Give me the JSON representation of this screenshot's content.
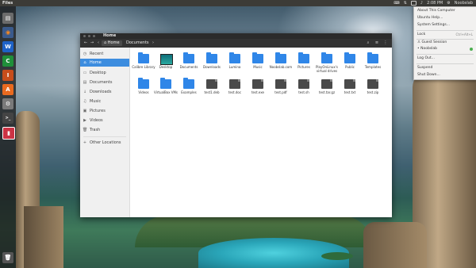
{
  "top_panel": {
    "app_title": "Files",
    "clock": "2:08 PM",
    "user": "Noobslab"
  },
  "launcher": {
    "items": [
      {
        "name": "files",
        "glyph": "▤",
        "color": "#6b6b6b"
      },
      {
        "name": "firefox",
        "glyph": "◉",
        "color": "#e66000"
      },
      {
        "name": "writer",
        "glyph": "W",
        "color": "#1e62c7"
      },
      {
        "name": "calc",
        "glyph": "C",
        "color": "#1f8f3a"
      },
      {
        "name": "impress",
        "glyph": "I",
        "color": "#c84d1b"
      },
      {
        "name": "software-center",
        "glyph": "A",
        "color": "#e96a1f"
      },
      {
        "name": "settings",
        "glyph": "⚙",
        "color": "#7a7a7a"
      },
      {
        "name": "terminal",
        "glyph": ">_",
        "color": "#444444"
      },
      {
        "name": "active-app",
        "glyph": "▮",
        "color": "#cc3344"
      },
      {
        "name": "trash",
        "glyph": "🗑",
        "color": "#555555"
      }
    ]
  },
  "window": {
    "title": "Home",
    "toolbar": {
      "back_icon": "←",
      "forward_icon": "→",
      "prev_icon": "‹",
      "home_label": "Home",
      "documents_label": "Documents",
      "next_icon": "›",
      "search_icon": "⌕",
      "list_icon": "≡",
      "menu_icon": "⋮"
    },
    "sidebar": {
      "items": [
        {
          "icon": "◷",
          "label": "Recent",
          "active": false
        },
        {
          "icon": "⌂",
          "label": "Home",
          "active": true
        },
        {
          "icon": "▭",
          "label": "Desktop",
          "active": false
        },
        {
          "icon": "▤",
          "label": "Documents",
          "active": false
        },
        {
          "icon": "↓",
          "label": "Downloads",
          "active": false
        },
        {
          "icon": "♫",
          "label": "Music",
          "active": false
        },
        {
          "icon": "▣",
          "label": "Pictures",
          "active": false
        },
        {
          "icon": "▶",
          "label": "Videos",
          "active": false
        },
        {
          "icon": "🗑",
          "label": "Trash",
          "active": false
        },
        {
          "icon": "+",
          "label": "Other Locations",
          "active": false
        }
      ]
    },
    "files": {
      "row1": [
        {
          "label": "Calibre Library",
          "type": "folder"
        },
        {
          "label": "Desktop",
          "type": "desktop"
        },
        {
          "label": "Documents",
          "type": "folder"
        },
        {
          "label": "Downloads",
          "type": "folder"
        },
        {
          "label": "Lumina",
          "type": "folder"
        },
        {
          "label": "Music",
          "type": "folder"
        },
        {
          "label": "Noobslab.com",
          "type": "folder"
        },
        {
          "label": "Pictures",
          "type": "folder"
        },
        {
          "label": "PlayOnLinux's virtual drives",
          "type": "folder"
        },
        {
          "label": "Public",
          "type": "folder"
        },
        {
          "label": "Templates",
          "type": "folder"
        }
      ],
      "row2": [
        {
          "label": "Videos",
          "type": "folder"
        },
        {
          "label": "VirtualBox VMs",
          "type": "folder"
        },
        {
          "label": "Examples",
          "type": "folder"
        },
        {
          "label": "test1.deb",
          "type": "doc"
        },
        {
          "label": "test.doc",
          "type": "doc"
        },
        {
          "label": "test.exe",
          "type": "doc"
        },
        {
          "label": "test.pdf",
          "type": "doc"
        },
        {
          "label": "test.sh",
          "type": "doc"
        },
        {
          "label": "test.tar.gz",
          "type": "doc"
        },
        {
          "label": "test.txt",
          "type": "doc"
        },
        {
          "label": "test.zip",
          "type": "doc"
        }
      ]
    }
  },
  "session_menu": {
    "about": "About This Computer",
    "help": "Ubuntu Help...",
    "settings": "System Settings...",
    "lock": "Lock",
    "lock_shortcut": "Ctrl+Alt+L",
    "guest": "Guest Session",
    "user": "Noobslab",
    "logout": "Log Out...",
    "suspend": "Suspend",
    "shutdown": "Shut Down..."
  }
}
